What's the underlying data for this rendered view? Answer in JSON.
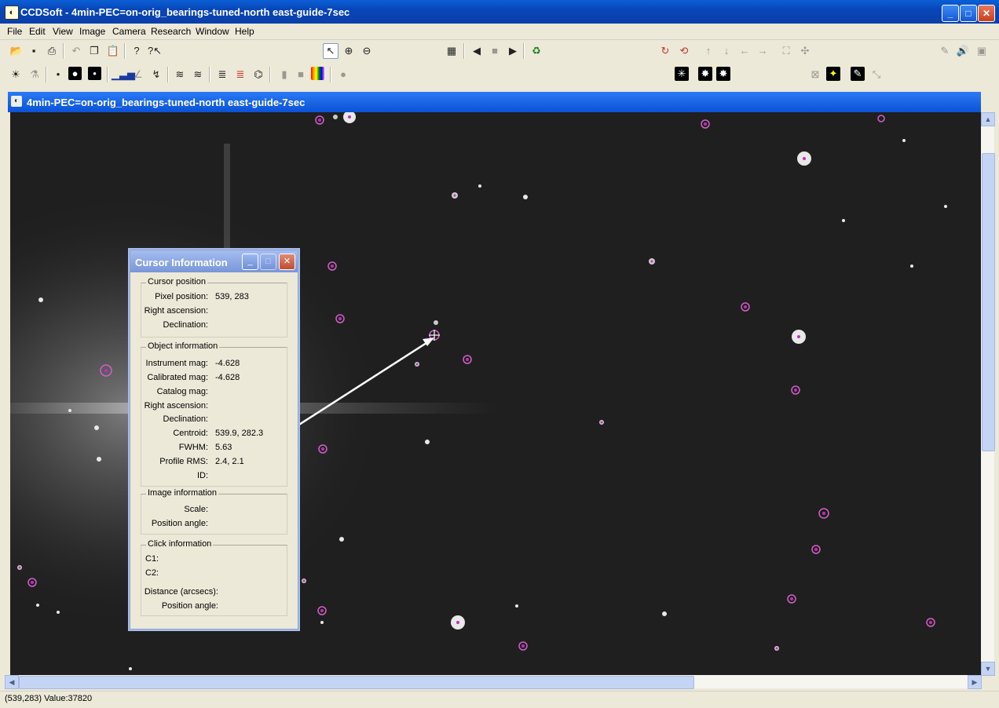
{
  "app": {
    "title": "CCDSoft  - 4min-PEC=on-orig_bearings-tuned-north east-guide-7sec"
  },
  "menu": [
    "File",
    "Edit",
    "View",
    "Image",
    "Camera",
    "Research",
    "Window",
    "Help"
  ],
  "image_window": {
    "title": "4min-PEC=on-orig_bearings-tuned-north east-guide-7sec"
  },
  "status": {
    "text": "(539,283) Value:37820"
  },
  "dialog": {
    "title": "Cursor Information",
    "cursor_position": {
      "heading": "Cursor position",
      "pixel_label": "Pixel position:",
      "pixel_value": "539, 283",
      "ra_label": "Right ascension:",
      "dec_label": "Declination:"
    },
    "object_info": {
      "heading": "Object information",
      "inst_label": "Instrument mag:",
      "inst_value": "-4.628",
      "cal_label": "Calibrated mag:",
      "cal_value": "-4.628",
      "cat_label": "Catalog mag:",
      "ra_label": "Right ascension:",
      "dec_label": "Declination:",
      "centroid_label": "Centroid:",
      "centroid_value": "539.9, 282.3",
      "fwhm_label": "FWHM:",
      "fwhm_value": "5.63",
      "rms_label": "Profile RMS:",
      "rms_value": "2.4, 2.1",
      "id_label": "ID:"
    },
    "image_info": {
      "heading": "Image information",
      "scale_label": "Scale:",
      "pa_label": "Position angle:"
    },
    "click_info": {
      "heading": "Click information",
      "c1_label": "C1:",
      "c2_label": "C2:",
      "dist_label": "Distance (arcsecs):",
      "pa_label": "Position angle:"
    }
  }
}
